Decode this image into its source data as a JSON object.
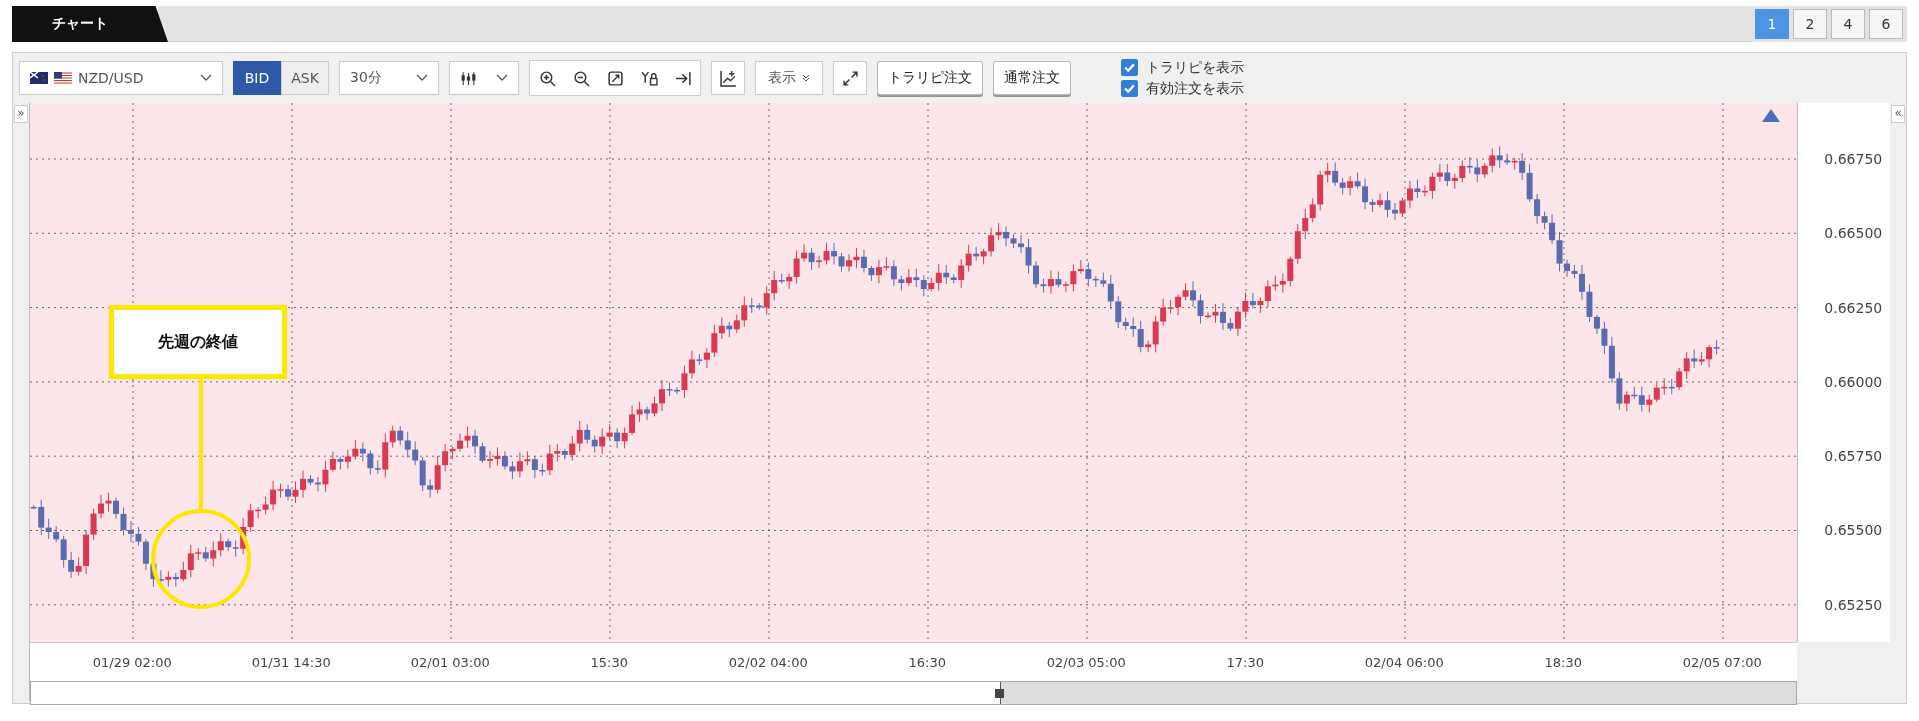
{
  "chart_tab": "チャート",
  "layout_buttons": [
    {
      "label": "1",
      "selected": true
    },
    {
      "label": "2",
      "selected": false
    },
    {
      "label": "4",
      "selected": false
    },
    {
      "label": "6",
      "selected": false
    }
  ],
  "toolbar": {
    "symbol": "NZD/USD",
    "price_side": [
      {
        "label": "BID",
        "selected": true
      },
      {
        "label": "ASK",
        "selected": false
      }
    ],
    "timeframe": "30分",
    "display_menu": "表示",
    "order_buttons": [
      "トラリピ注文",
      "通常注文"
    ],
    "checkboxes": [
      {
        "label": "トラリピを表示",
        "checked": true
      },
      {
        "label": "有効注文を表示",
        "checked": true
      }
    ]
  },
  "chart": {
    "y_labels": [
      "0.66750",
      "0.66500",
      "0.66250",
      "0.66000",
      "0.65750",
      "0.65500",
      "0.65250"
    ],
    "x_labels": [
      "01/29 02:00",
      "01/31 14:30",
      "02/01 03:00",
      "15:30",
      "02/02 04:00",
      "16:30",
      "02/03 05:00",
      "17:30",
      "02/04 06:00",
      "18:30",
      "02/05 07:00"
    ],
    "annotation": "先週の終値",
    "collapse_left": "»",
    "collapse_right": "«"
  }
}
